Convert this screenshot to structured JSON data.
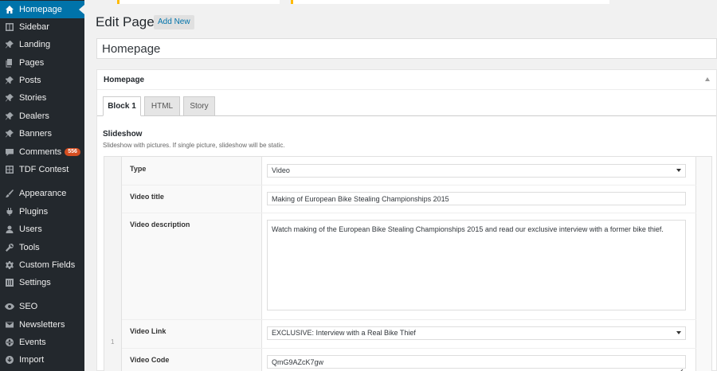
{
  "sidebar": {
    "items": [
      {
        "label": "Homepage",
        "icon": "home-icon",
        "active": true
      },
      {
        "label": "Sidebar",
        "icon": "columns-icon"
      },
      {
        "label": "Landing",
        "icon": "pin-icon"
      },
      {
        "label": "Pages",
        "icon": "pages-icon"
      },
      {
        "label": "Posts",
        "icon": "pin-icon"
      },
      {
        "label": "Stories",
        "icon": "pin-icon"
      },
      {
        "label": "Dealers",
        "icon": "pin-icon"
      },
      {
        "label": "Banners",
        "icon": "pin-icon"
      },
      {
        "label": "Comments",
        "icon": "comment-icon",
        "badge": "556"
      },
      {
        "label": "TDF Contest",
        "icon": "grid-icon"
      },
      {
        "label": "Appearance",
        "icon": "brush-icon"
      },
      {
        "label": "Plugins",
        "icon": "plug-icon"
      },
      {
        "label": "Users",
        "icon": "user-icon"
      },
      {
        "label": "Tools",
        "icon": "wrench-icon"
      },
      {
        "label": "Custom Fields",
        "icon": "gear-icon"
      },
      {
        "label": "Settings",
        "icon": "sliders-icon"
      },
      {
        "label": "SEO",
        "icon": "seo-icon"
      },
      {
        "label": "Newsletters",
        "icon": "mail-icon"
      },
      {
        "label": "Events",
        "icon": "globe-icon"
      },
      {
        "label": "Import",
        "icon": "import-icon"
      }
    ]
  },
  "header": {
    "title": "Edit Page",
    "add_new_label": "Add New"
  },
  "post_title_value": "Homepage",
  "postbox": {
    "title": "Homepage",
    "tabs": [
      {
        "label": "Block 1",
        "active": true
      },
      {
        "label": "HTML"
      },
      {
        "label": "Story"
      }
    ],
    "section": {
      "title": "Slideshow",
      "description": "Slideshow with pictures. If single picture, slideshow will be static."
    },
    "row_number": "1",
    "fields": {
      "type": {
        "label": "Type",
        "value": "Video"
      },
      "video_title": {
        "label": "Video title",
        "value": "Making of European Bike Stealing Championships 2015"
      },
      "video_description": {
        "label": "Video description",
        "value": "Watch making of the European Bike Stealing Championships 2015 and read our exclusive interview with a former bike thief."
      },
      "video_link": {
        "label": "Video Link",
        "value": "EXCLUSIVE: Interview with a Real Bike Thief"
      },
      "video_code": {
        "label": "Video Code",
        "value": "QmG9AZcK7gw"
      }
    }
  },
  "colors": {
    "sidebar_bg": "#23282d",
    "active_menu": "#0073aa",
    "badge": "#d54e21",
    "notice_border": "#ffba00"
  }
}
